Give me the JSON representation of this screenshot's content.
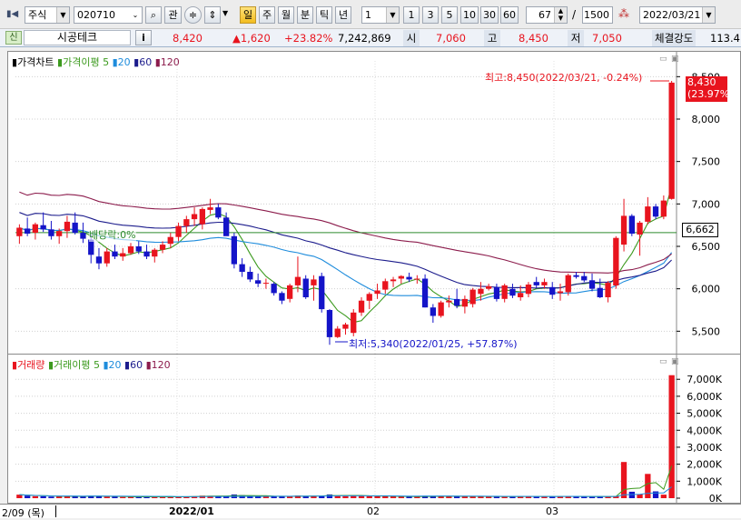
{
  "toolbar": {
    "market": "주식",
    "code": "020710",
    "btn_gwan": "관",
    "periods": [
      "일",
      "주",
      "월",
      "분",
      "틱",
      "년"
    ],
    "interval_value": "1",
    "quick_intervals": [
      "1",
      "3",
      "5",
      "10",
      "30",
      "60"
    ],
    "count_value": "67",
    "slash": "/",
    "total_value": "1500",
    "date_value": "2022/03/21"
  },
  "quote": {
    "tag": "신",
    "name": "시공테크",
    "info_btn": "i",
    "price": "8,420",
    "change": "▲1,620",
    "change_pct": "+23.82%",
    "volume": "7,242,869",
    "open_label": "시",
    "open_value": "7,060",
    "high_label": "고",
    "high_value": "8,450",
    "low_label": "저",
    "low_value": "7,050",
    "strength_label": "체결강도",
    "strength_value": "113.4"
  },
  "price_panel": {
    "title": "가격차트",
    "ma_label": "가격이평",
    "ma_periods": [
      "5",
      "20",
      "60",
      "120"
    ],
    "max_annotation": "최고:8,450(2022/03/21, -0.24%)",
    "min_annotation": "최저:5,340(2022/01/25, +57.87%)",
    "dividend_label": "배당락:0%",
    "current_price_tag": "8,430",
    "current_pct_tag": "(23.97%)",
    "hline_tag": "6,662"
  },
  "volume_panel": {
    "title": "거래량",
    "ma_label": "거래이평",
    "ma_periods": [
      "5",
      "20",
      "60",
      "120"
    ]
  },
  "x_axis": {
    "start_label": "2/09 (목)",
    "ticks": [
      "2022/01",
      "02",
      "03"
    ]
  },
  "colors": {
    "up": "#e8141e",
    "down": "#1414c8",
    "ma5": "#3c9a1e",
    "ma20": "#1e8cdc",
    "ma60": "#1c1c8c",
    "ma120": "#8c1c4c",
    "hline": "#2e8b2e",
    "panel_bg": "#ffffff"
  },
  "chart_data": [
    {
      "type": "candlestick",
      "title": "가격차트",
      "y_ticks": [
        5500,
        6000,
        6500,
        7000,
        7500,
        8000,
        8500
      ],
      "ylim": [
        5300,
        8600
      ],
      "x_labels": [
        "2022/01",
        "02",
        "03"
      ],
      "grid": true,
      "legend": "top-left",
      "horizontal_line": 6662,
      "candles": [
        [
          6620,
          6760,
          6530,
          6720
        ],
        [
          6710,
          6840,
          6620,
          6650
        ],
        [
          6660,
          6780,
          6580,
          6760
        ],
        [
          6750,
          6900,
          6670,
          6700
        ],
        [
          6700,
          6800,
          6580,
          6620
        ],
        [
          6620,
          6710,
          6530,
          6680
        ],
        [
          6680,
          6860,
          6600,
          6790
        ],
        [
          6780,
          6900,
          6640,
          6660
        ],
        [
          6660,
          6780,
          6540,
          6590
        ],
        [
          6580,
          6640,
          6300,
          6400
        ],
        [
          6380,
          6480,
          6230,
          6300
        ],
        [
          6300,
          6480,
          6260,
          6440
        ],
        [
          6440,
          6520,
          6350,
          6380
        ],
        [
          6380,
          6480,
          6330,
          6420
        ],
        [
          6420,
          6540,
          6400,
          6500
        ],
        [
          6500,
          6560,
          6410,
          6440
        ],
        [
          6440,
          6520,
          6350,
          6380
        ],
        [
          6380,
          6480,
          6310,
          6460
        ],
        [
          6460,
          6560,
          6420,
          6520
        ],
        [
          6530,
          6660,
          6480,
          6610
        ],
        [
          6610,
          6780,
          6560,
          6740
        ],
        [
          6740,
          6860,
          6660,
          6820
        ],
        [
          6820,
          6960,
          6740,
          6880
        ],
        [
          6760,
          6960,
          6700,
          6940
        ],
        [
          6930,
          7060,
          6880,
          6960
        ],
        [
          6960,
          7000,
          6820,
          6840
        ],
        [
          6840,
          6900,
          6640,
          6620
        ],
        [
          6620,
          6660,
          6240,
          6290
        ],
        [
          6290,
          6360,
          6140,
          6200
        ],
        [
          6200,
          6260,
          6080,
          6110
        ],
        [
          6100,
          6180,
          6020,
          6060
        ],
        [
          6060,
          6120,
          6000,
          6070
        ],
        [
          6060,
          6080,
          5920,
          5950
        ],
        [
          5950,
          5970,
          5820,
          5860
        ],
        [
          5880,
          6060,
          5840,
          6040
        ],
        [
          6040,
          6380,
          5960,
          6140
        ],
        [
          6120,
          6160,
          5880,
          5900
        ],
        [
          6040,
          6160,
          5860,
          6110
        ],
        [
          6150,
          6190,
          5720,
          5760
        ],
        [
          5750,
          5760,
          5340,
          5430
        ],
        [
          5430,
          5560,
          5420,
          5530
        ],
        [
          5530,
          5600,
          5460,
          5580
        ],
        [
          5480,
          5760,
          5440,
          5720
        ],
        [
          5720,
          5900,
          5680,
          5860
        ],
        [
          5860,
          5960,
          5760,
          5940
        ],
        [
          5940,
          6060,
          5880,
          5980
        ],
        [
          5990,
          6120,
          5940,
          6090
        ],
        [
          6090,
          6140,
          6020,
          6110
        ],
        [
          6120,
          6160,
          6060,
          6150
        ],
        [
          6140,
          6190,
          6080,
          6110
        ],
        [
          6110,
          6160,
          6060,
          6120
        ],
        [
          6120,
          6170,
          5780,
          5780
        ],
        [
          5780,
          5820,
          5600,
          5680
        ],
        [
          5680,
          5860,
          5660,
          5840
        ],
        [
          5840,
          5920,
          5780,
          5860
        ],
        [
          5880,
          6000,
          5770,
          5800
        ],
        [
          5790,
          5920,
          5710,
          5880
        ],
        [
          5820,
          6010,
          5780,
          5990
        ],
        [
          5940,
          6080,
          5860,
          6000
        ],
        [
          6000,
          6060,
          5980,
          6030
        ],
        [
          6020,
          6060,
          5850,
          5880
        ],
        [
          5880,
          6060,
          5840,
          6040
        ],
        [
          6000,
          6060,
          5890,
          5920
        ],
        [
          5900,
          6040,
          5860,
          5950
        ],
        [
          5940,
          6080,
          5900,
          6050
        ],
        [
          6080,
          6140,
          6010,
          6040
        ],
        [
          6040,
          6120,
          6000,
          6080
        ],
        [
          6020,
          6080,
          5880,
          5930
        ],
        [
          5950,
          6060,
          5860,
          5970
        ],
        [
          5960,
          6180,
          5920,
          6160
        ],
        [
          6160,
          6200,
          6120,
          6140
        ],
        [
          6150,
          6200,
          6080,
          6100
        ],
        [
          6100,
          6180,
          5970,
          6000
        ],
        [
          6010,
          6120,
          5890,
          5900
        ],
        [
          5900,
          6090,
          5840,
          6070
        ],
        [
          6040,
          6620,
          6000,
          6600
        ],
        [
          6520,
          7060,
          6440,
          6860
        ],
        [
          6860,
          6880,
          6620,
          6650
        ],
        [
          6640,
          6800,
          6390,
          6780
        ],
        [
          6790,
          7080,
          6760,
          6970
        ],
        [
          6970,
          7000,
          6820,
          6850
        ],
        [
          6850,
          7100,
          6820,
          7040
        ],
        [
          7060,
          8450,
          7050,
          8430
        ]
      ]
    },
    {
      "type": "bar",
      "title": "거래량",
      "y_ticks": [
        0,
        1000,
        2000,
        3000,
        4000,
        5000,
        6000,
        7000
      ],
      "y_unit": "K",
      "ylim": [
        0,
        7600
      ],
      "values": [
        210,
        150,
        120,
        110,
        90,
        100,
        130,
        120,
        100,
        140,
        120,
        90,
        80,
        70,
        80,
        90,
        80,
        70,
        70,
        80,
        90,
        100,
        110,
        150,
        140,
        130,
        110,
        220,
        180,
        130,
        110,
        100,
        100,
        110,
        120,
        160,
        110,
        140,
        150,
        220,
        160,
        120,
        150,
        140,
        120,
        110,
        110,
        100,
        90,
        90,
        90,
        140,
        130,
        110,
        100,
        110,
        110,
        110,
        100,
        90,
        90,
        90,
        100,
        110,
        120,
        90,
        90,
        110,
        100,
        110,
        90,
        90,
        100,
        110,
        90,
        120,
        2130,
        380,
        240,
        1430,
        400,
        210,
        7240
      ]
    }
  ]
}
